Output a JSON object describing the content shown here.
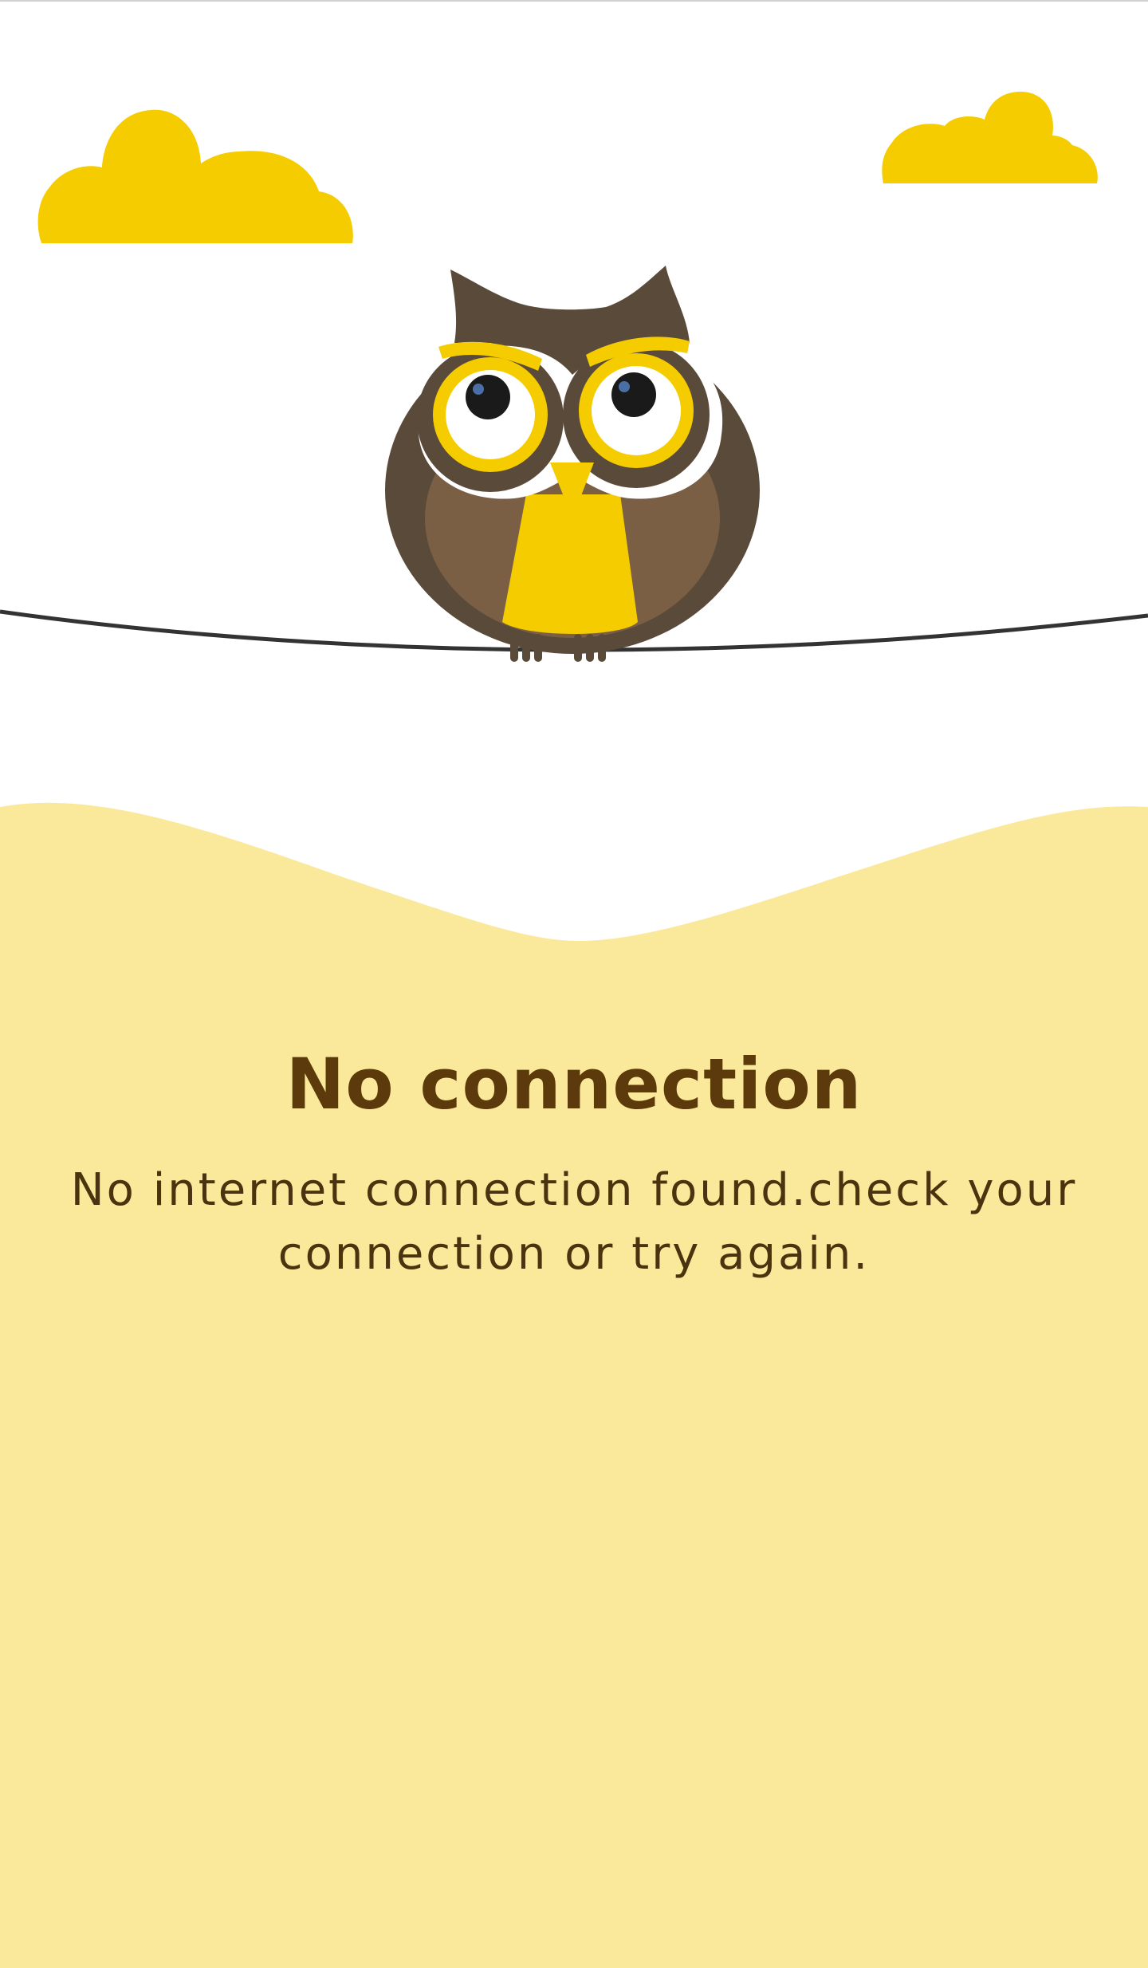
{
  "error_screen": {
    "title": "No connection",
    "message": "No internet connection found.check your connection or try again."
  },
  "colors": {
    "background": "#ffffff",
    "wave_fill": "#fbe99b",
    "cloud": "#f5cc00",
    "title_text": "#5c3a0c",
    "message_text": "#4a3410",
    "owl_dark": "#5a4a3a",
    "owl_body": "#7a5f45",
    "owl_accent": "#f5cc00"
  },
  "icons": {
    "owl": "owl-mascot-icon",
    "cloud_left": "cloud-icon",
    "cloud_right": "cloud-icon",
    "wire": "wire-line"
  }
}
